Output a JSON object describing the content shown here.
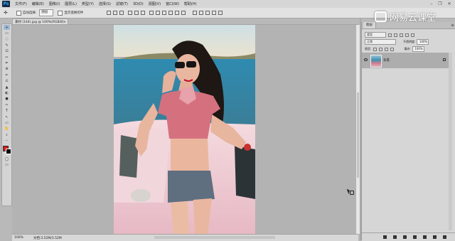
{
  "app": {
    "logo_text": "Ps"
  },
  "menu": [
    "文件(F)",
    "编辑(E)",
    "图像(I)",
    "图层(L)",
    "类型(Y)",
    "选择(S)",
    "滤镜(T)",
    "3D(D)",
    "视图(V)",
    "窗口(W)",
    "帮助(H)"
  ],
  "window_controls": {
    "minimize": "–",
    "maximize": "❐",
    "close": "✕"
  },
  "options": {
    "tool_glyph": "✛",
    "auto_select_label": "自动选择:",
    "auto_select_value": "图层",
    "transform_controls_label": "显示变换控件"
  },
  "watermark": {
    "text": "网易云课堂"
  },
  "tools": [
    "✛",
    "▭",
    "◌",
    "✎",
    "⊡",
    "✂",
    "✒",
    "⊕",
    "✏",
    "⎌",
    "▲",
    "◐",
    "●",
    "✑",
    "T",
    "↖",
    "▭",
    "✋",
    "⌕",
    "⋯"
  ],
  "document": {
    "tab_title": "素材 (144).jpg @ 100%(RGB/8)",
    "tab_close": "×"
  },
  "status": {
    "zoom": "100%",
    "doc_info": "文档:3.52M/3.52M"
  },
  "layers_panel": {
    "tab_label": "图层",
    "menu_glyph": "≡",
    "kind_filter": "类型",
    "blend_mode": "正常",
    "opacity_label": "不透明度:",
    "opacity_value": "100%",
    "lock_label": "锁定:",
    "fill_label": "填充:",
    "fill_value": "100%",
    "layers": [
      {
        "name": "背景",
        "visible": true,
        "locked": true
      }
    ]
  }
}
